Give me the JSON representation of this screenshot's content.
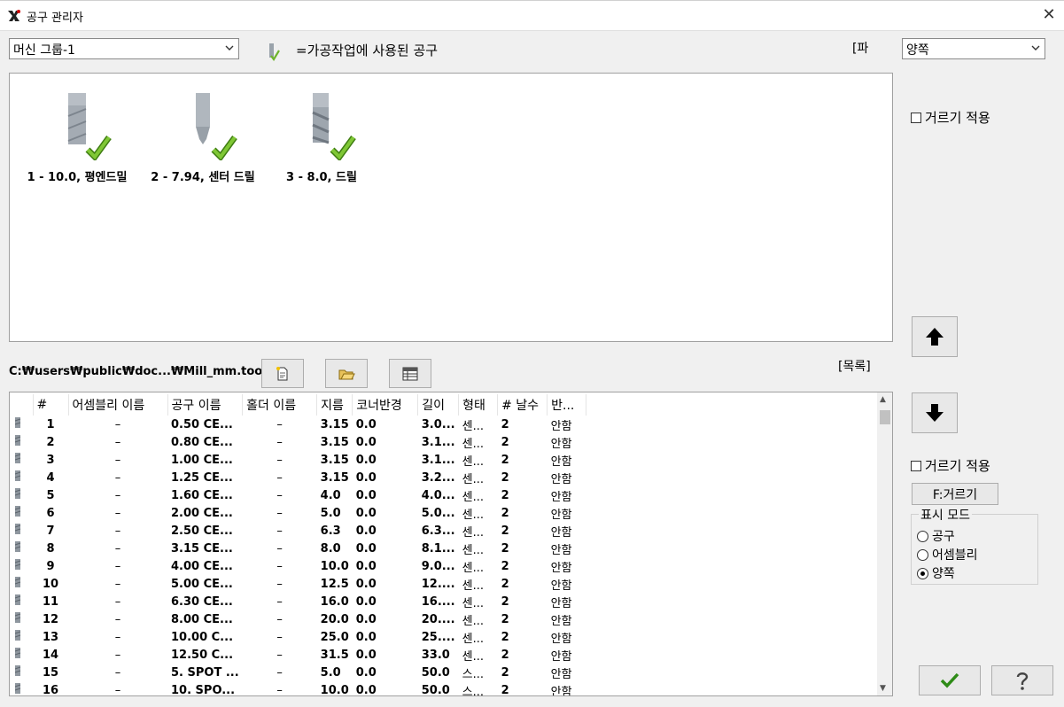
{
  "window": {
    "title": "공구 관리자",
    "close_glyph": "✕"
  },
  "machine_group": {
    "value": "머신 그룹-1"
  },
  "legend": {
    "text": "=가공작업에 사용된 공구"
  },
  "pa_label": "[파",
  "display_dropdown": {
    "value": "양쪽"
  },
  "tools": [
    {
      "label": "1 - 10.0, 평엔드밀",
      "icon": "flat-endmill-icon"
    },
    {
      "label": "2 - 7.94, 센터 드릴",
      "icon": "center-drill-icon"
    },
    {
      "label": "3 - 8.0, 드릴",
      "icon": "drill-icon"
    }
  ],
  "filter_top": {
    "label": "거르기 적용"
  },
  "library_path": "C:₩users₩public₩doc...₩Mill_mm.tooldb",
  "list_label": "[목록]",
  "table": {
    "headers": [
      "#",
      "어셈블리 이름",
      "공구 이름",
      "홀더 이름",
      "지름",
      "코너반경",
      "길이",
      "형태",
      "# 날수",
      "반..."
    ],
    "rows": [
      [
        "1",
        "–",
        "0.50 CE...",
        "–",
        "3.15",
        "0.0",
        "3.0...",
        "센...",
        "2",
        "안함"
      ],
      [
        "2",
        "–",
        "0.80 CE...",
        "–",
        "3.15",
        "0.0",
        "3.1...",
        "센...",
        "2",
        "안함"
      ],
      [
        "3",
        "–",
        "1.00 CE...",
        "–",
        "3.15",
        "0.0",
        "3.1...",
        "센...",
        "2",
        "안함"
      ],
      [
        "4",
        "–",
        "1.25 CE...",
        "–",
        "3.15",
        "0.0",
        "3.2...",
        "센...",
        "2",
        "안함"
      ],
      [
        "5",
        "–",
        "1.60 CE...",
        "–",
        "4.0",
        "0.0",
        "4.0...",
        "센...",
        "2",
        "안함"
      ],
      [
        "6",
        "–",
        "2.00 CE...",
        "–",
        "5.0",
        "0.0",
        "5.0...",
        "센...",
        "2",
        "안함"
      ],
      [
        "7",
        "–",
        "2.50 CE...",
        "–",
        "6.3",
        "0.0",
        "6.3...",
        "센...",
        "2",
        "안함"
      ],
      [
        "8",
        "–",
        "3.15 CE...",
        "–",
        "8.0",
        "0.0",
        "8.1...",
        "센...",
        "2",
        "안함"
      ],
      [
        "9",
        "–",
        "4.00 CE...",
        "–",
        "10.0",
        "0.0",
        "9.0...",
        "센...",
        "2",
        "안함"
      ],
      [
        "10",
        "–",
        "5.00 CE...",
        "–",
        "12.5",
        "0.0",
        "12....",
        "센...",
        "2",
        "안함"
      ],
      [
        "11",
        "–",
        "6.30 CE...",
        "–",
        "16.0",
        "0.0",
        "16....",
        "센...",
        "2",
        "안함"
      ],
      [
        "12",
        "–",
        "8.00 CE...",
        "–",
        "20.0",
        "0.0",
        "20....",
        "센...",
        "2",
        "안함"
      ],
      [
        "13",
        "–",
        "10.00 C...",
        "–",
        "25.0",
        "0.0",
        "25....",
        "센...",
        "2",
        "안함"
      ],
      [
        "14",
        "–",
        "12.50 C...",
        "–",
        "31.5",
        "0.0",
        "33.0",
        "센...",
        "2",
        "안함"
      ],
      [
        "15",
        "–",
        "5. SPOT ...",
        "–",
        "5.0",
        "0.0",
        "50.0",
        "스...",
        "2",
        "안함"
      ],
      [
        "16",
        "–",
        "10. SPO...",
        "–",
        "10.0",
        "0.0",
        "50.0",
        "스...",
        "2",
        "안함"
      ]
    ]
  },
  "filter_bottom": {
    "label": "거르기 적용"
  },
  "filter_button": {
    "label": "F:거르기"
  },
  "display_mode": {
    "title": "표시 모드",
    "options": [
      "공구",
      "어셈블리",
      "양쪽"
    ],
    "selected": "양쪽"
  },
  "colors": {
    "check_green": "#6fb52c",
    "tool_grey": "#a9b0b8"
  }
}
